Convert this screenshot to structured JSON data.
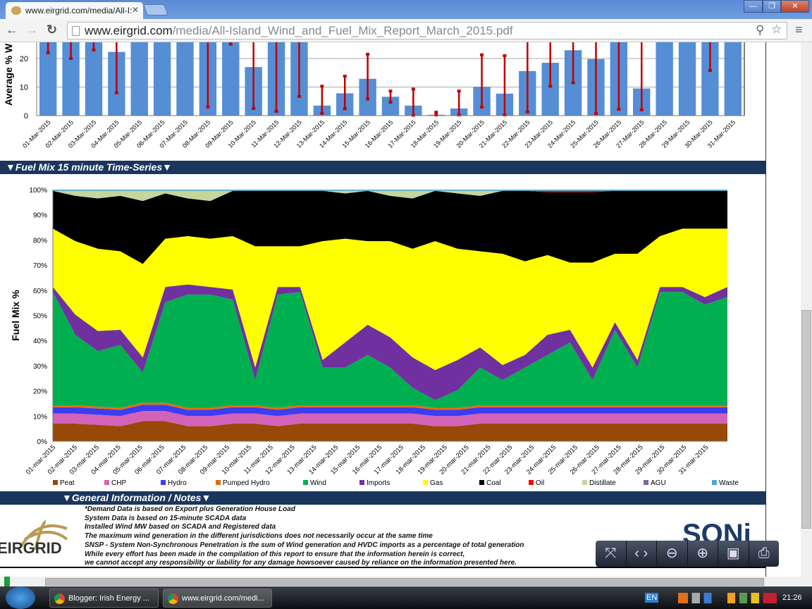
{
  "browser": {
    "tab_title": "www.eirgrid.com/media/All-I:",
    "url_host": "www.eirgrid.com",
    "url_path": "/media/All-Island_Wind_and_Fuel_Mix_Report_March_2015.pdf",
    "minimize": "—",
    "restore": "❐",
    "close": "✕"
  },
  "sections": {
    "fuel_mix": "▼Fuel Mix 15 minute Time-Series▼",
    "notes": "▼General Information / Notes▼"
  },
  "notes": {
    "lines": [
      "*Demand Data is based on Export plus Generation House Load",
      "System Data is based on 15-minute SCADA data",
      "Installed Wind MW based on SCADA and Registered data",
      "The maximum wind generation in the different jurisdictions does not necessarily occur at the same time",
      "SNSP - System Non-Synchronous Penetration is the sum of Wind generation and HVDC imports as a percentage of total generation",
      "While every effort has been made in the compilation of this report to ensure that the information herein is correct,",
      "we cannot accept any responsibility or liability for any damage howsoever caused by reliance on the information presented here."
    ],
    "logo_left": "EIRGRID",
    "logo_right": "SONi"
  },
  "taskbar": {
    "items": [
      "Blogger: Irish Energy ...",
      "www.eirgrid.com/medi..."
    ],
    "lang": "EN",
    "clock": "21:26"
  },
  "chart_data": [
    {
      "type": "bar",
      "title": "",
      "ylabel": "Average % W",
      "ylim": [
        0,
        25.4
      ],
      "yticks": [
        0,
        10,
        20
      ],
      "bar_color": "#558ed5",
      "error_color": "#c00000",
      "categories": [
        "01-Mar-2015",
        "02-Mar-2015",
        "03-Mar-2015",
        "04-Mar-2015",
        "05-Mar-2015",
        "06-Mar-2015",
        "07-Mar-2015",
        "08-Mar-2015",
        "09-Mar-2015",
        "10-Mar-2015",
        "11-Mar-2015",
        "12-Mar-2015",
        "13-Mar-2015",
        "14-Mar-2015",
        "15-Mar-2015",
        "16-Mar-2015",
        "17-Mar-2015",
        "18-Mar-2015",
        "19-Mar-2015",
        "20-Mar-2015",
        "21-Mar-2015",
        "22-Mar-2015",
        "23-Mar-2015",
        "24-Mar-2015",
        "25-Mar-2015",
        "26-Mar-2015",
        "27-Mar-2015",
        "28-Mar-2015",
        "29-Mar-2015",
        "30-Mar-2015",
        "31-Mar-2015"
      ],
      "values": [
        32,
        30,
        33,
        22.3,
        40,
        45,
        40,
        30,
        35,
        17,
        30,
        32,
        3.5,
        7.8,
        12.9,
        6.6,
        3.5,
        0.3,
        2.5,
        10.1,
        7.7,
        15.6,
        18.5,
        22.9,
        19.8,
        35,
        9.5,
        40,
        40,
        35,
        35
      ],
      "err_min": [
        22,
        20,
        23,
        8,
        null,
        null,
        null,
        3,
        25,
        2.5,
        1.5,
        6.7,
        0.8,
        2.4,
        5.8,
        4.7,
        0.1,
        0.2,
        0.2,
        3,
        0.2,
        1.3,
        10.3,
        11.5,
        0.7,
        2.2,
        2,
        null,
        null,
        15.8,
        null
      ],
      "err_max": [
        40,
        40,
        40,
        40,
        null,
        null,
        null,
        40,
        40,
        40,
        40,
        40,
        10.3,
        13.8,
        21.5,
        8.6,
        9.3,
        1.2,
        8.6,
        21.3,
        21,
        40,
        40,
        40,
        40,
        40,
        40,
        null,
        null,
        40,
        null
      ]
    },
    {
      "type": "area",
      "stacked": true,
      "ylabel": "Fuel Mix %",
      "ylim": [
        0,
        100
      ],
      "yticks": [
        "0%",
        "10%",
        "20%",
        "30%",
        "40%",
        "50%",
        "60%",
        "70%",
        "80%",
        "90%",
        "100%"
      ],
      "legend": "bottom",
      "categories": [
        "01-mar-2015",
        "02-mar-2015",
        "03-mar-2015",
        "04-mar-2015",
        "05-mar-2015",
        "06-mar-2015",
        "07-mar-2015",
        "08-mar-2015",
        "09-mar-2015",
        "10-mar-2015",
        "11-mar-2015",
        "12-mar-2015",
        "13-mar-2015",
        "14-mar-2015",
        "15-mar-2015",
        "16-mar-2015",
        "17-mar-2015",
        "18-mar-2015",
        "19-mar-2015",
        "20-mar-2015",
        "21-mar-2015",
        "22-mar-2015",
        "23-mar-2015",
        "24-mar-2015",
        "25-mar-2015",
        "26-mar-2015",
        "27-mar-2015",
        "28-mar-2015",
        "29-mar-2015",
        "30-mar-2015",
        "31-mar-2015"
      ],
      "series": [
        {
          "name": "Peat",
          "color": "#984807",
          "values": [
            7,
            7,
            6.5,
            6,
            8,
            8,
            6,
            6,
            7,
            7,
            6,
            7,
            7,
            7,
            7,
            7,
            7,
            6,
            6,
            7,
            7,
            7,
            7,
            7,
            7,
            7,
            7,
            7,
            7,
            7,
            7
          ]
        },
        {
          "name": "CHP",
          "color": "#d462b8",
          "values": [
            4,
            4,
            4,
            4,
            4,
            4,
            4,
            4,
            4,
            4,
            4,
            4,
            4,
            4,
            4,
            4,
            4,
            4,
            4,
            4,
            4,
            4,
            4,
            4,
            4,
            4,
            4,
            4,
            4,
            4,
            4
          ]
        },
        {
          "name": "Hydro",
          "color": "#3d3df0",
          "values": [
            2.5,
            2.5,
            2.5,
            2.5,
            2.5,
            2.5,
            2.5,
            2.5,
            2.5,
            2.5,
            2.5,
            2.5,
            2.5,
            2.5,
            2.5,
            2.5,
            2.5,
            2.5,
            2.5,
            2.5,
            2.5,
            2.5,
            2.5,
            2.5,
            2.5,
            2.5,
            2.5,
            2.5,
            2.5,
            2.5,
            2.5
          ]
        },
        {
          "name": "Pumped Hydro",
          "color": "#e46c0a",
          "values": [
            0.8,
            0.8,
            0.8,
            0.8,
            0.8,
            0.8,
            0.8,
            0.8,
            0.8,
            0.8,
            0.8,
            0.8,
            0.8,
            0.8,
            0.8,
            0.8,
            0.8,
            0.8,
            0.8,
            0.8,
            0.8,
            0.8,
            0.8,
            0.8,
            0.8,
            0.8,
            0.8,
            0.8,
            0.8,
            0.8,
            0.8
          ]
        },
        {
          "name": "Wind",
          "color": "#00b050",
          "values": [
            45,
            28,
            22,
            25,
            12,
            40,
            45,
            45,
            42,
            10,
            45,
            45,
            15,
            15,
            20,
            15,
            7,
            3,
            7,
            15,
            10,
            15,
            20,
            25,
            10,
            30,
            15,
            45,
            45,
            40,
            43
          ]
        },
        {
          "name": "Imports",
          "color": "#7030a0",
          "values": [
            2,
            8,
            8,
            6,
            6,
            6,
            4,
            3,
            4,
            5,
            3,
            2,
            3,
            10,
            12,
            12,
            12,
            12,
            12,
            8,
            6,
            5,
            8,
            5,
            5,
            3,
            3,
            2,
            2,
            3,
            4
          ]
        },
        {
          "name": "Gas",
          "color": "#ffff00",
          "remainder": true
        },
        {
          "name": "Coal",
          "color": "#000000",
          "values": [
            15,
            18,
            20,
            22,
            25,
            18,
            15,
            15,
            18,
            22,
            22,
            22,
            20,
            18,
            20,
            18,
            20,
            20,
            22,
            22,
            25,
            28,
            25,
            28,
            28,
            25,
            25,
            18,
            15,
            15,
            15
          ]
        },
        {
          "name": "Oil",
          "color": "#ff0000",
          "values": [
            0,
            0,
            0,
            0,
            0,
            0,
            0,
            0,
            0,
            0,
            0,
            0,
            0,
            0,
            0,
            0,
            0,
            0,
            0,
            0,
            0,
            0,
            0.5,
            0.5,
            0.5,
            0,
            0,
            0,
            0,
            0,
            0
          ]
        },
        {
          "name": "Distillate",
          "color": "#c3d69b",
          "values": [
            0,
            2,
            3,
            2,
            4,
            1,
            3,
            4,
            0,
            0,
            0,
            0,
            0,
            1,
            0,
            2,
            3,
            0,
            1,
            2,
            0,
            0,
            0,
            0,
            0,
            0,
            0,
            0,
            0,
            0,
            0
          ]
        },
        {
          "name": "AGU",
          "color": "#8064a2",
          "values": [
            0,
            0,
            0,
            0,
            0,
            0,
            0,
            0,
            0,
            0,
            0,
            0,
            0,
            0,
            0,
            0,
            0,
            0,
            0,
            0,
            0,
            0,
            0,
            0,
            0,
            0,
            0,
            0,
            0,
            0,
            0
          ]
        },
        {
          "name": "Waste",
          "color": "#4bacc6",
          "values": [
            0.5,
            0.5,
            0.5,
            0.5,
            0.5,
            0.5,
            0.5,
            0.5,
            0.5,
            0.5,
            0.5,
            0.5,
            0.5,
            0.5,
            0.5,
            0.5,
            0.5,
            0.5,
            0.5,
            0.5,
            0.5,
            0.5,
            0.5,
            0.5,
            0.5,
            0.5,
            0.5,
            0.5,
            0.5,
            0.5,
            0.5
          ]
        }
      ]
    }
  ]
}
